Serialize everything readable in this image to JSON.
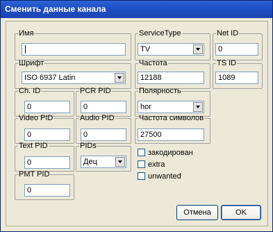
{
  "window": {
    "title": "Сменить данные канала"
  },
  "fields": {
    "name": {
      "label": "Имя",
      "value": ""
    },
    "service_type": {
      "label": "ServiceType",
      "value": "TV"
    },
    "net_id": {
      "label": "Net ID",
      "value": "0"
    },
    "font": {
      "label": "Шрифт",
      "value": "ISO 6937 Latin"
    },
    "frequency": {
      "label": "Частота",
      "value": "12188"
    },
    "ts_id": {
      "label": "TS ID",
      "value": "1089"
    },
    "ch_id": {
      "label": "Ch. ID",
      "value": "0"
    },
    "pcr_pid": {
      "label": "PCR PID",
      "value": "0"
    },
    "polarity": {
      "label": "Полярность",
      "value": "hor"
    },
    "video_pid": {
      "label": "Video PID",
      "value": "0"
    },
    "audio_pid": {
      "label": "Audio PID",
      "value": "0"
    },
    "symbol_rate": {
      "label": "Частота символов",
      "value": "27500"
    },
    "text_pid": {
      "label": "Text PID",
      "value": "0"
    },
    "pids": {
      "label": "PIDs",
      "value": "Дец"
    },
    "pmt_pid": {
      "label": "PMT PID",
      "value": "0"
    }
  },
  "checkboxes": {
    "encoded": "закодирован",
    "extra": "extra",
    "unwanted": "unwanted"
  },
  "buttons": {
    "cancel": "Отмена",
    "ok": "OK"
  }
}
